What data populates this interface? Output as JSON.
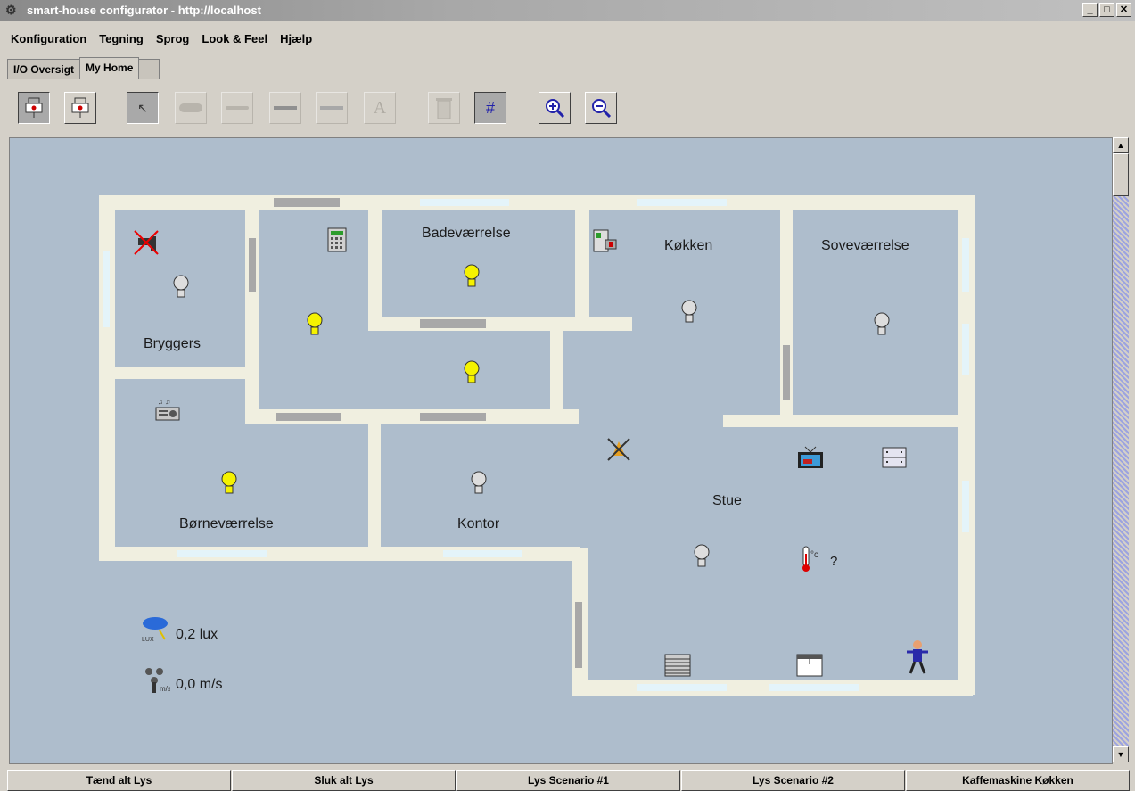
{
  "window": {
    "title": "smart-house configurator - http://localhost"
  },
  "menu": [
    "Konfiguration",
    "Tegning",
    "Sprog",
    "Look & Feel",
    "Hjælp"
  ],
  "tabs": [
    {
      "label": "I/O Oversigt"
    },
    {
      "label": "My Home"
    }
  ],
  "rooms": {
    "bryggers": "Bryggers",
    "badevaerelse": "Badeværrelse",
    "kokken": "Køkken",
    "sovevaerelse": "Soveværrelse",
    "bornevaerelse": "Børneværrelse",
    "kontor": "Kontor",
    "stue": "Stue"
  },
  "sensors": {
    "light_value": "0,2 lux",
    "wind_value": "0,0 m/s",
    "temp_value": "?"
  },
  "bottom_buttons": [
    "Tænd alt Lys",
    "Sluk alt Lys",
    "Lys Scenario #1",
    "Lys Scenario #2",
    "Kaffemaskine Køkken"
  ],
  "colors": {
    "floor": "#aebdcc",
    "wall": "#f0efe0",
    "door": "#a8a8a8",
    "window": "#e4f4fa",
    "bulb_on": "#f5f200"
  }
}
